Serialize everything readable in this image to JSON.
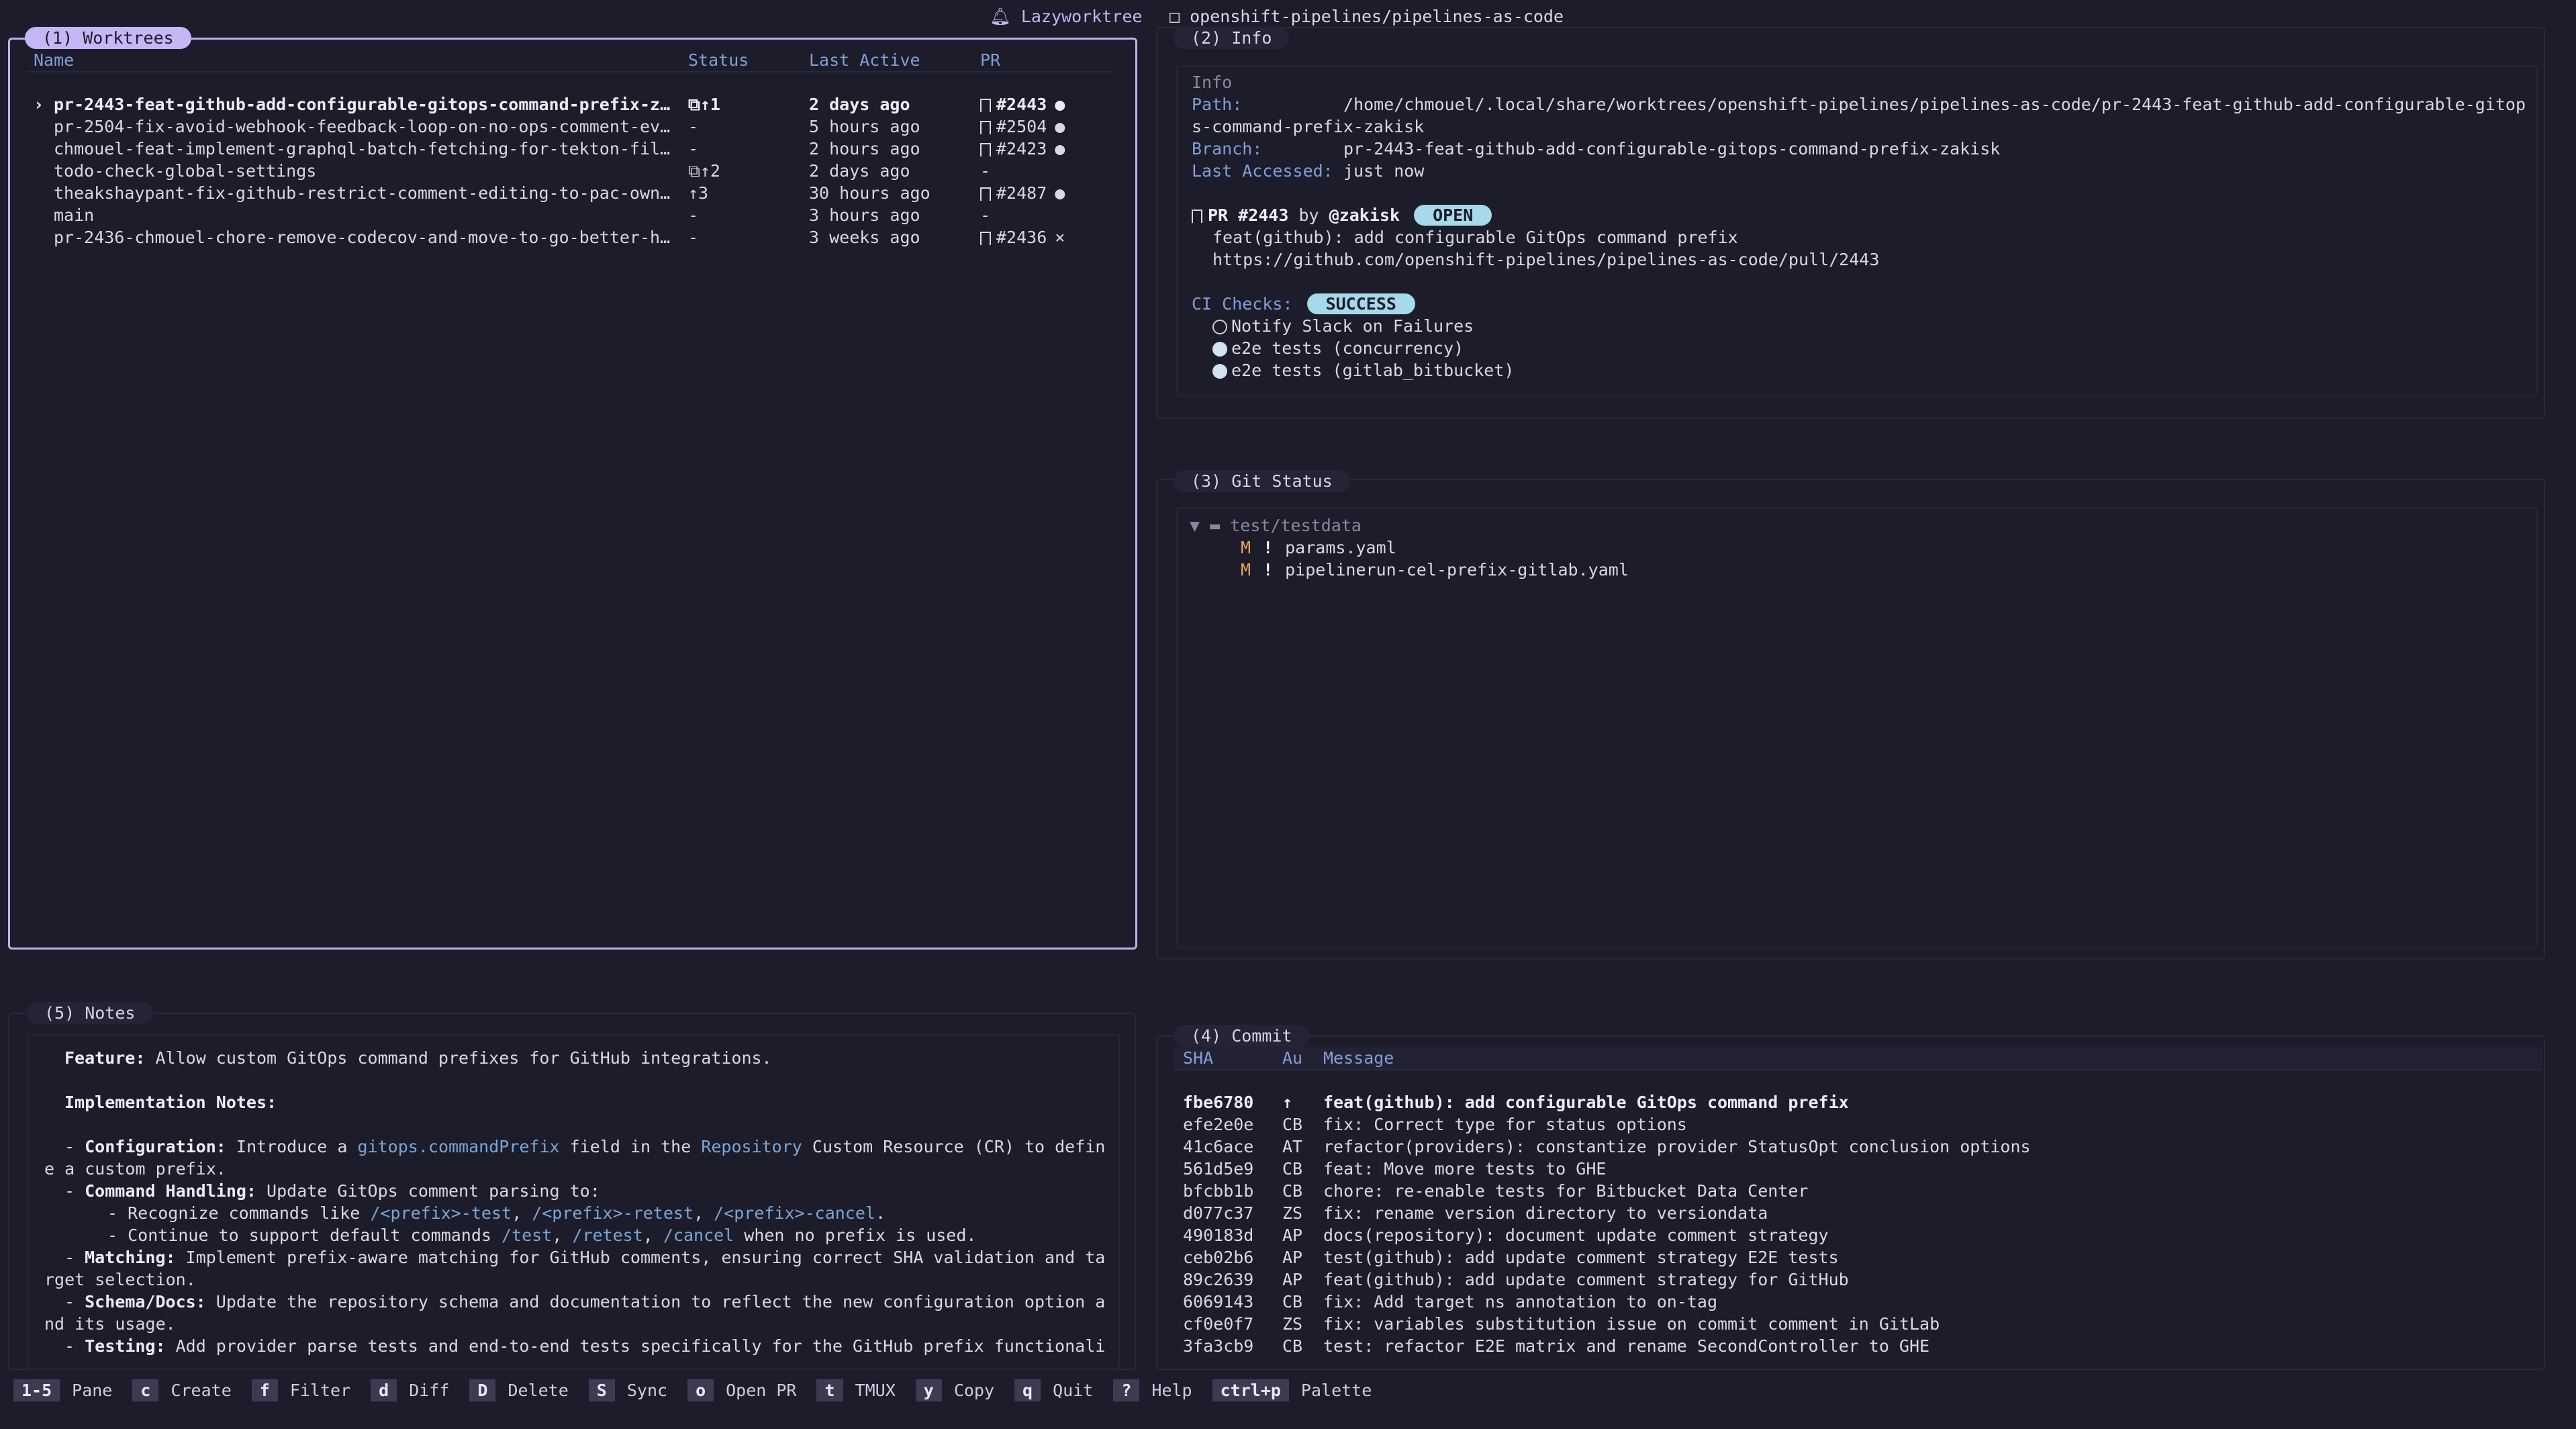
{
  "topbar": {
    "app_name": "Lazyworktree",
    "repo": "openshift-pipelines/pipelines-as-code"
  },
  "worktrees": {
    "title": "(1) Worktrees",
    "columns": [
      "Name",
      "Status",
      "Last Active",
      "PR"
    ],
    "rows": [
      {
        "marker": "›",
        "name": "pr-2443-feat-github-add-configurable-gitops-command-prefix-z…",
        "status": "⧉↑1",
        "last_active": "2 days ago",
        "pr": "#2443",
        "pr_state": "●"
      },
      {
        "marker": "",
        "name": "pr-2504-fix-avoid-webhook-feedback-loop-on-no-ops-comment-ev…",
        "status": "-",
        "last_active": "5 hours ago",
        "pr": "#2504",
        "pr_state": "●"
      },
      {
        "marker": "",
        "name": "chmouel-feat-implement-graphql-batch-fetching-for-tekton-fil…",
        "status": "-",
        "last_active": "2 hours ago",
        "pr": "#2423",
        "pr_state": "●"
      },
      {
        "marker": "",
        "name": "todo-check-global-settings",
        "status": "⧉↑2",
        "last_active": "2 days ago",
        "pr": "-",
        "pr_state": ""
      },
      {
        "marker": "",
        "name": "theakshaypant-fix-github-restrict-comment-editing-to-pac-own…",
        "status": "↑3",
        "last_active": "30 hours ago",
        "pr": "#2487",
        "pr_state": "●"
      },
      {
        "marker": "",
        "name": "main",
        "status": "-",
        "last_active": "3 hours ago",
        "pr": "-",
        "pr_state": ""
      },
      {
        "marker": "",
        "name": "pr-2436-chmouel-chore-remove-codecov-and-move-to-go-better-h…",
        "status": "-",
        "last_active": "3 weeks ago",
        "pr": "#2436",
        "pr_state": "×"
      }
    ]
  },
  "info": {
    "title": "(2) Info",
    "section": "Info",
    "path_label": "Path:",
    "path_line1": "/home/chmouel/.local/share/worktrees/openshift-pipelines/pipelines-as-code/pr-2443-feat-github-add-configurable-gitop",
    "path_line2": "s-command-prefix-zakisk",
    "branch_label": "Branch:",
    "branch": "pr-2443-feat-github-add-configurable-gitops-command-prefix-zakisk",
    "last_accessed_label": "Last Accessed:",
    "last_accessed": "just now",
    "pr_heading": "PR #2443",
    "pr_by": "by",
    "pr_author": "@zakisk",
    "pr_state": "OPEN",
    "pr_title": "feat(github): add configurable GitOps command prefix",
    "pr_url": "https://github.com/openshift-pipelines/pipelines-as-code/pull/2443",
    "ci_label": "CI Checks:",
    "ci_status": "SUCCESS",
    "checks": [
      {
        "name": "Notify Slack on Failures",
        "passed": false
      },
      {
        "name": "e2e tests (concurrency)",
        "passed": true
      },
      {
        "name": "e2e tests (gitlab_bitbucket)",
        "passed": true
      }
    ]
  },
  "git_status": {
    "title": "(3) Git Status",
    "folder": "test/testdata",
    "files": [
      {
        "flag": "M",
        "mark": "!",
        "name": "params.yaml"
      },
      {
        "flag": "M",
        "mark": "!",
        "name": "pipelinerun-cel-prefix-gitlab.yaml"
      }
    ]
  },
  "notes": {
    "title": "(5) Notes",
    "feature_label": "Feature:",
    "feature_text": "Allow custom GitOps command prefixes for GitHub integrations.",
    "impl_heading": "Implementation Notes:",
    "config_label": "Configuration:",
    "config_pre": "Introduce a",
    "config_code": "gitops.commandPrefix",
    "config_mid": "field in the",
    "config_repo": "Repository",
    "config_post": "Custom Resource (CR) to defin",
    "config_wrap": "e a custom prefix.",
    "cmd_label": "Command Handling:",
    "cmd_text": "Update GitOps comment parsing to:",
    "cmd_recognize": "- Recognize commands like",
    "cmd_c1": "/<prefix>-test",
    "cmd_c2": "/<prefix>-retest",
    "cmd_c3": "/<prefix>-cancel",
    "cmd_continue": "- Continue to support default commands",
    "cmd_d1": "/test",
    "cmd_d2": "/retest",
    "cmd_d3": "/cancel",
    "cmd_continue_post": "when no prefix is used.",
    "match_label": "Matching:",
    "match_text": "Implement prefix-aware matching for GitHub comments, ensuring correct SHA validation and ta",
    "match_wrap": "rget selection.",
    "schema_label": "Schema/Docs:",
    "schema_text": "Update the repository schema and documentation to reflect the new configuration option a",
    "schema_wrap": "nd its usage.",
    "testing_label": "Testing:",
    "testing_text": "Add provider parse tests and end-to-end tests specifically for the GitHub prefix functionali"
  },
  "commits": {
    "title": "(4) Commit",
    "columns": [
      "SHA",
      "Au",
      "Message"
    ],
    "rows": [
      {
        "sha": "fbe6780",
        "author": "↑",
        "message": "feat(github): add configurable GitOps command prefix"
      },
      {
        "sha": "efe2e0e",
        "author": "CB",
        "message": "fix: Correct type for status options"
      },
      {
        "sha": "41c6ace",
        "author": "AT",
        "message": "refactor(providers): constantize provider StatusOpt conclusion options"
      },
      {
        "sha": "561d5e9",
        "author": "CB",
        "message": "feat: Move more tests to GHE"
      },
      {
        "sha": "bfcbb1b",
        "author": "CB",
        "message": "chore: re-enable tests for Bitbucket Data Center"
      },
      {
        "sha": "d077c37",
        "author": "ZS",
        "message": "fix: rename version directory to versiondata"
      },
      {
        "sha": "490183d",
        "author": "AP",
        "message": "docs(repository): document update comment strategy"
      },
      {
        "sha": "ceb02b6",
        "author": "AP",
        "message": "test(github): add update comment strategy E2E tests"
      },
      {
        "sha": "89c2639",
        "author": "AP",
        "message": "feat(github): add update comment strategy for GitHub"
      },
      {
        "sha": "6069143",
        "author": "CB",
        "message": "fix: Add target ns annotation to on-tag"
      },
      {
        "sha": "cf0e0f7",
        "author": "ZS",
        "message": "fix: variables substitution issue on commit comment in GitLab"
      },
      {
        "sha": "3fa3cb9",
        "author": "CB",
        "message": "test: refactor E2E matrix and rename SecondController to GHE"
      }
    ]
  },
  "footer": {
    "shortcuts": [
      {
        "key": "1-5",
        "label": "Pane"
      },
      {
        "key": "c",
        "label": "Create"
      },
      {
        "key": "f",
        "label": "Filter"
      },
      {
        "key": "d",
        "label": "Diff"
      },
      {
        "key": "D",
        "label": "Delete"
      },
      {
        "key": "S",
        "label": "Sync"
      },
      {
        "key": "o",
        "label": "Open PR"
      },
      {
        "key": "t",
        "label": "TMUX"
      },
      {
        "key": "y",
        "label": "Copy"
      },
      {
        "key": "q",
        "label": "Quit"
      },
      {
        "key": "?",
        "label": "Help"
      },
      {
        "key": "ctrl+p",
        "label": "Palette"
      }
    ]
  },
  "colors": {
    "background": "#1d1c2b",
    "accent": "#c6b6f5",
    "badge_open": "#a6d9ea",
    "badge_success": "#a6d9ea",
    "header_blue": "#7f9fd8",
    "modified_orange": "#e6a45a"
  }
}
